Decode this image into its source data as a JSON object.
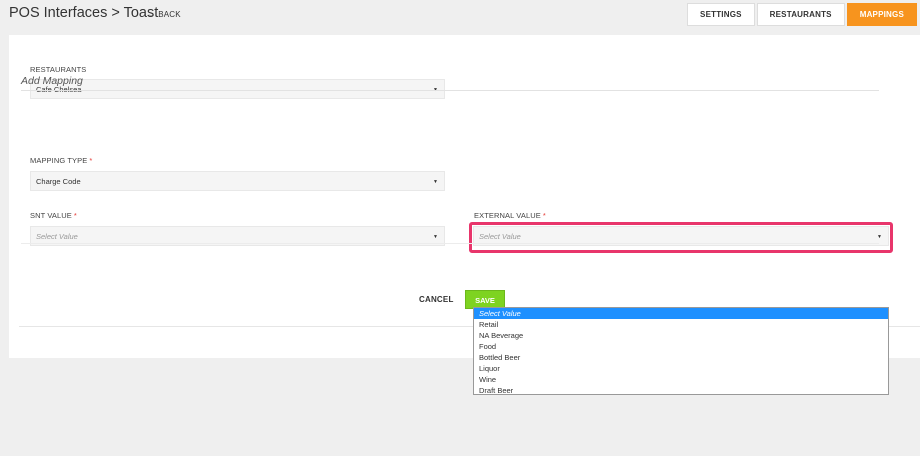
{
  "header": {
    "title": "POS Interfaces > Toast",
    "back_label": "BACK",
    "tabs": [
      {
        "label": "SETTINGS",
        "active": false
      },
      {
        "label": "RESTAURANTS",
        "active": false
      },
      {
        "label": "MAPPINGS",
        "active": true
      }
    ],
    "accent_color": "#f7941e"
  },
  "form": {
    "restaurants_label": "RESTAURANTS",
    "restaurants_value": "Cafe Chelsea",
    "section_title": "Add Mapping",
    "mapping_type_label": "MAPPING TYPE",
    "mapping_type_value": "Charge Code",
    "snt_value_label": "SNT VALUE",
    "snt_value_placeholder": "Select Value",
    "external_value_label": "EXTERNAL VALUE",
    "external_value_placeholder": "Select Value",
    "required_mark": "*",
    "highlight_color": "#e8356b"
  },
  "actions": {
    "cancel_label": "CANCEL",
    "save_label": "SAVE",
    "save_color": "#7ed321"
  },
  "dropdown": {
    "options": [
      "Select Value",
      "Retail",
      "NA Beverage",
      "Food",
      "Bottled Beer",
      "Liquor",
      "Wine",
      "Draft Beer"
    ],
    "selected_index": 0,
    "selected_color": "#1e90ff"
  }
}
